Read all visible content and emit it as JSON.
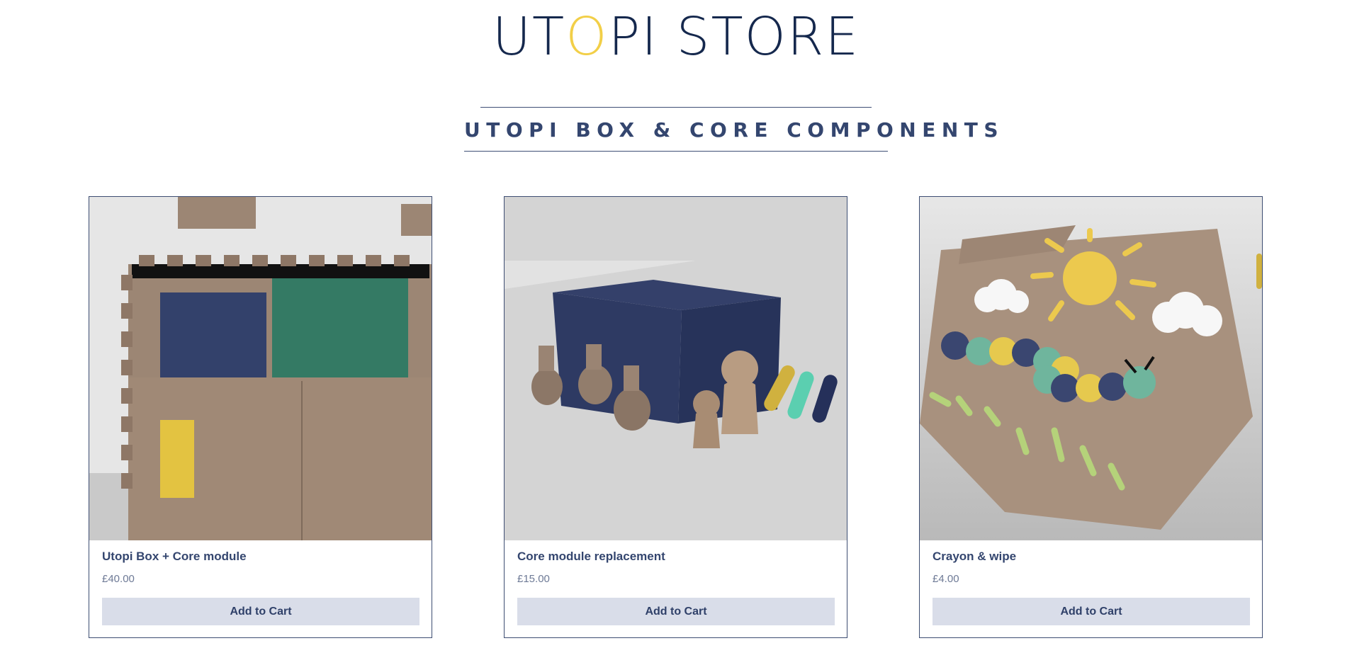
{
  "header": {
    "logo_part1": "UT",
    "logo_accent": "O",
    "logo_part2": "PI STORE"
  },
  "section": {
    "title": "UTOPI BOX & CORE COMPONENTS"
  },
  "products": [
    {
      "name": "Utopi Box + Core module",
      "price": "£40.00",
      "button": "Add to Cart"
    },
    {
      "name": "Core module replacement",
      "price": "£15.00",
      "button": "Add to Cart"
    },
    {
      "name": "Crayon & wipe",
      "price": "£4.00",
      "button": "Add to Cart"
    }
  ],
  "colors": {
    "navy": "#15284d",
    "accent_yellow": "#f2cf48",
    "button_bg": "#d9dde9",
    "card_border": "#3d4d72"
  }
}
